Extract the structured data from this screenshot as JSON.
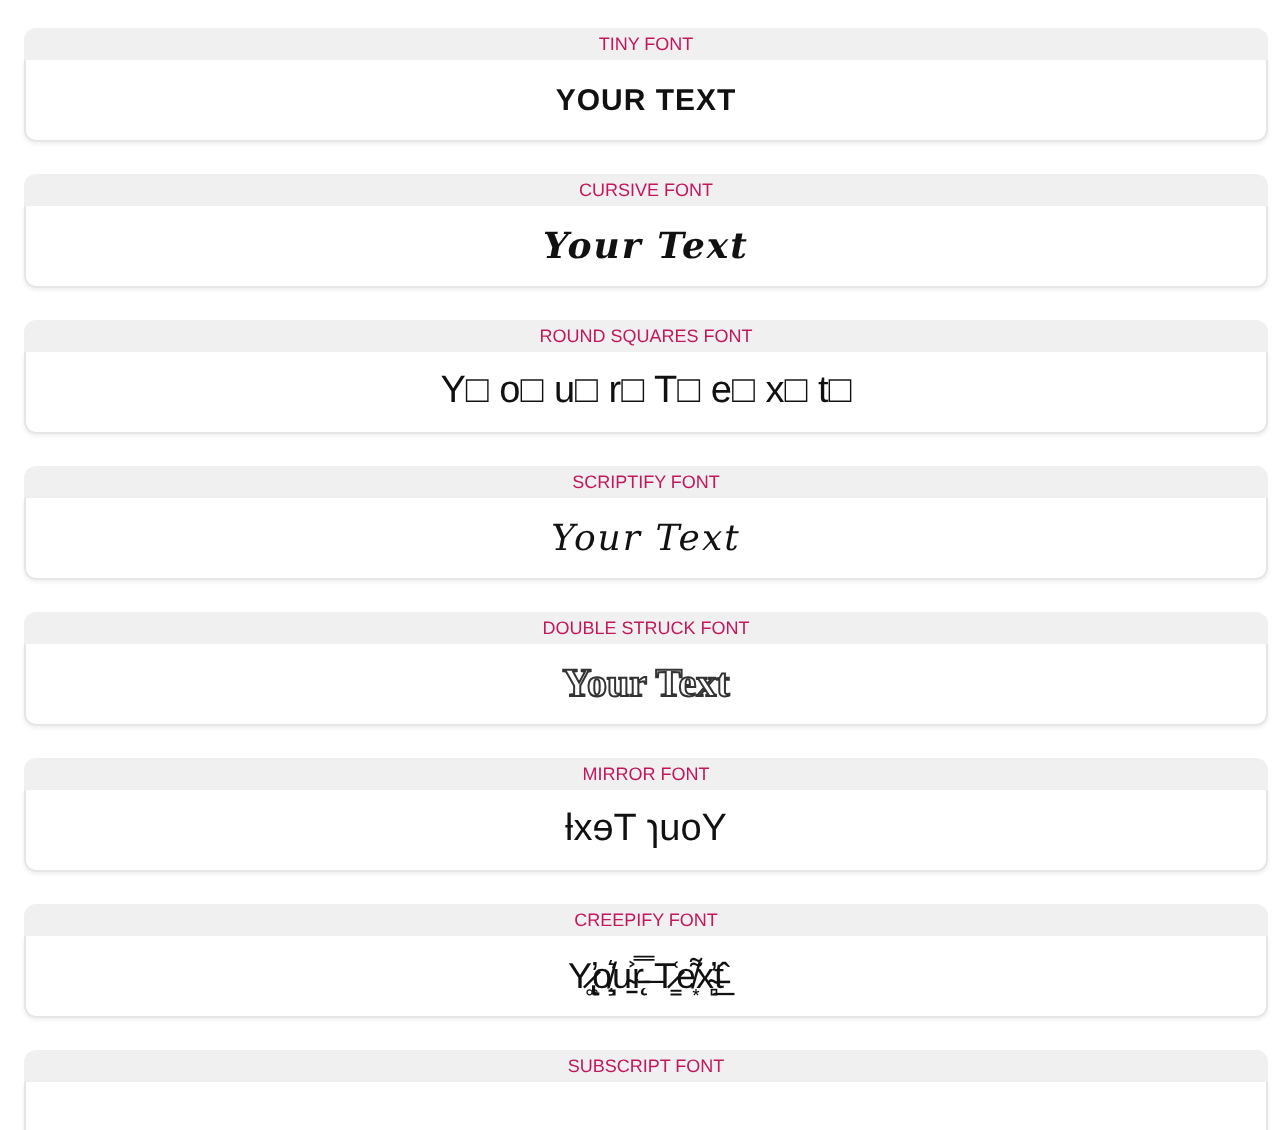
{
  "fonts": [
    {
      "label": "TINY FONT",
      "kind": "caps",
      "sample": "YOUR TEXT"
    },
    {
      "label": "CURSIVE FONT",
      "kind": "cursive",
      "sample": "Your Text"
    },
    {
      "label": "ROUND SQUARES FONT",
      "kind": "plain",
      "sample": "Y□ o□ u□ r□ T□ e□ x□ t□"
    },
    {
      "label": "SCRIPTIFY FONT",
      "kind": "script",
      "sample": "Your Text"
    },
    {
      "label": "DOUBLE STRUCK FONT",
      "kind": "outline",
      "sample": "Your Text"
    },
    {
      "label": "MIRROR FONT",
      "kind": "plain",
      "sample": "ƚxɘT ɿuoY"
    },
    {
      "label": "CREEPIFY FONT",
      "kind": "creepy",
      "sample": "Y̷̢̛͚o̸̧͉͛u̴̠͐r̵̨̿ ̶T̷̳͑e̸͙͌x̴̻̓t̵̲̂"
    },
    {
      "label": "SUBSCRIPT FONT",
      "kind": "plain"
    }
  ]
}
